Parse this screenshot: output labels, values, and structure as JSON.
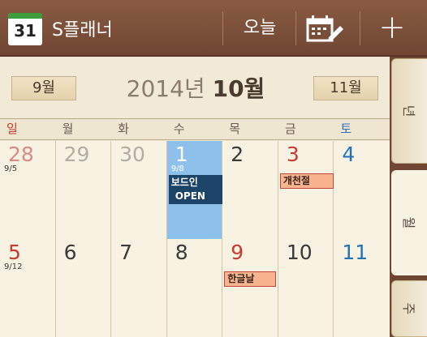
{
  "app": {
    "icon_label": "31",
    "title": "S플래너"
  },
  "toolbar": {
    "today_label": "오늘",
    "calendar_icon": "calendar-edit-icon",
    "add_icon": "plus-icon",
    "add_symbol": "+"
  },
  "month_nav": {
    "prev_label": "9월",
    "title_year": "2014년",
    "title_month": "10월",
    "next_label": "11월"
  },
  "weekdays": [
    "일",
    "월",
    "화",
    "수",
    "목",
    "금",
    "토"
  ],
  "weeks": [
    [
      {
        "day": "28",
        "lunar": "9/5",
        "style": "red-light"
      },
      {
        "day": "29",
        "style": "grey"
      },
      {
        "day": "30",
        "style": "grey"
      },
      {
        "day": "1",
        "lunar": "9/8",
        "style": "selnum",
        "selected": true,
        "events": [
          {
            "text": "보드인",
            "kind": "dark"
          },
          {
            "text": "OPEN",
            "kind": "dark"
          }
        ]
      },
      {
        "day": "2",
        "style": ""
      },
      {
        "day": "3",
        "style": "red",
        "events": [
          {
            "text": "개천절",
            "kind": "holiday"
          }
        ]
      },
      {
        "day": "4",
        "style": "blue"
      }
    ],
    [
      {
        "day": "5",
        "lunar": "9/12",
        "style": "red"
      },
      {
        "day": "6",
        "style": ""
      },
      {
        "day": "7",
        "style": ""
      },
      {
        "day": "8",
        "style": ""
      },
      {
        "day": "9",
        "style": "red",
        "events": [
          {
            "text": "한글날",
            "kind": "holiday"
          }
        ]
      },
      {
        "day": "10",
        "style": ""
      },
      {
        "day": "11",
        "style": "blue"
      }
    ]
  ],
  "side_tabs": [
    {
      "label": "년"
    },
    {
      "label": "월",
      "active": true
    },
    {
      "label": "주"
    }
  ],
  "colors": {
    "appbar": "#7a4e38",
    "selected_cell": "#8ec0ec",
    "event_dark": "#1c4468",
    "holiday_fill": "#f7b48e",
    "sunday": "#c83a30",
    "saturday": "#2a6ec2"
  }
}
